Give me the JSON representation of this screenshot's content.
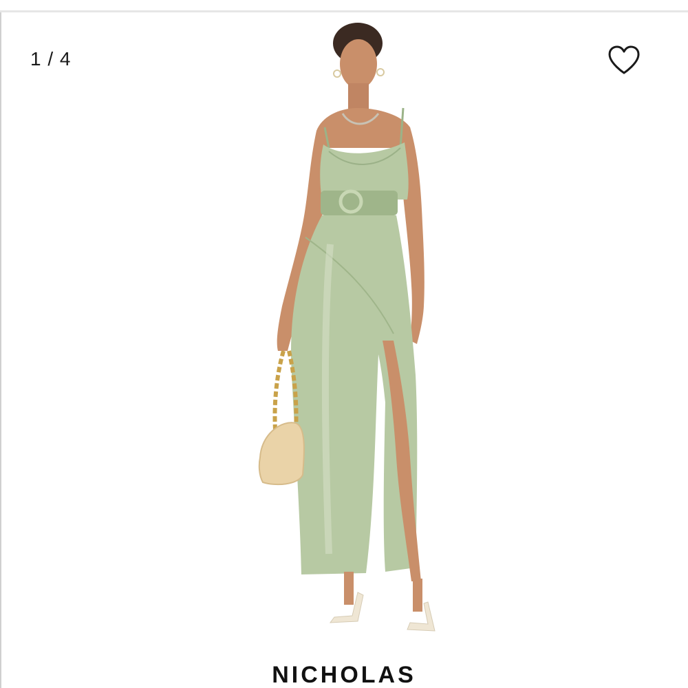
{
  "gallery": {
    "counter": "1 / 4",
    "favorite_icon": "heart-outline-icon"
  },
  "product": {
    "brand": "NICHOLAS"
  },
  "colors": {
    "dress": "#b7c9a3",
    "dress_shadow": "#8fa67c",
    "skin": "#c98f6a",
    "bag": "#ead3a8",
    "chain": "#c9a24a"
  }
}
